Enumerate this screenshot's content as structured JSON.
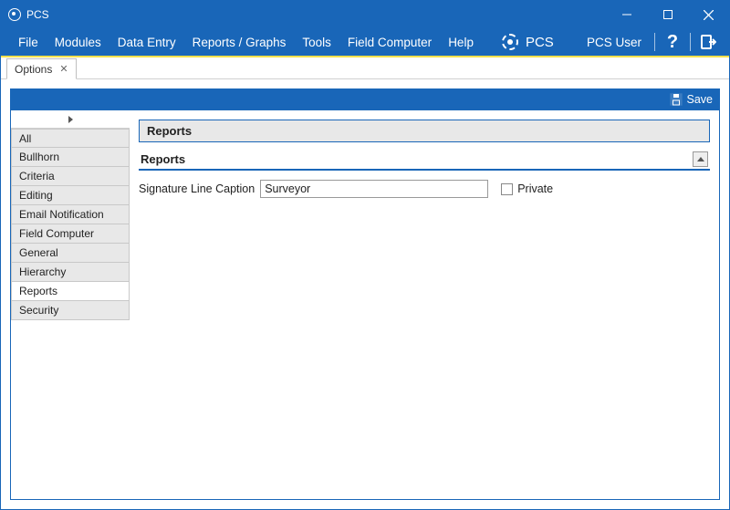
{
  "title": "PCS",
  "menus": {
    "file": "File",
    "modules": "Modules",
    "data_entry": "Data Entry",
    "reports_graphs": "Reports / Graphs",
    "tools": "Tools",
    "field_computer": "Field Computer",
    "help": "Help"
  },
  "brand": "PCS",
  "user_label": "PCS User",
  "tab": {
    "label": "Options"
  },
  "toolbar": {
    "save": "Save"
  },
  "sidebar": {
    "items": [
      "All",
      "Bullhorn",
      "Criteria",
      "Editing",
      "Email Notification",
      "Field Computer",
      "General",
      "Hierarchy",
      "Reports",
      "Security"
    ],
    "selected_index": 8
  },
  "panel": {
    "title": "Reports",
    "subtitle": "Reports",
    "signature_label": "Signature Line Caption",
    "signature_value": "Surveyor",
    "private_label": "Private",
    "private_checked": false
  }
}
